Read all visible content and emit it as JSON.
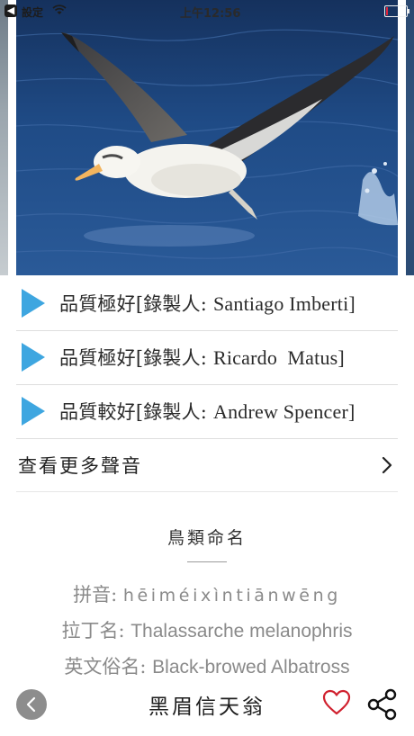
{
  "status_bar": {
    "carrier": "設定",
    "time": "上午12:56",
    "back_icon": "back-arrow-icon",
    "wifi_icon": "wifi-icon",
    "battery_color": "#e0243b"
  },
  "hero": {
    "photo_icon": "albatross-photo"
  },
  "recordings": [
    {
      "quality": "品質極好",
      "prefix": "[錄製人:",
      "recorder": "Santiago Imberti]",
      "icon": "play-icon"
    },
    {
      "quality": "品質極好",
      "prefix": "[錄製人:",
      "recorder": "Ricardo  Matus]",
      "icon": "play-icon"
    },
    {
      "quality": "品質較好",
      "prefix": "[錄製人:",
      "recorder": "Andrew Spencer]",
      "icon": "play-icon"
    }
  ],
  "more_sounds": {
    "label": "查看更多聲音",
    "icon": "chevron-right-icon"
  },
  "naming": {
    "title": "鳥類命名",
    "pinyin_label": "拼音:",
    "pinyin_value": "hēiméixìntiānwēng",
    "latin_label": "拉丁名:",
    "latin_value": "Thalassarche melanophris",
    "english_label": "英文俗名:",
    "english_value": "Black-browed Albatross"
  },
  "bottom_bar": {
    "title": "黑眉信天翁",
    "back_icon": "back-circle-icon",
    "favorite_icon": "heart-icon",
    "share_icon": "share-icon",
    "heart_color": "#d0202e"
  }
}
